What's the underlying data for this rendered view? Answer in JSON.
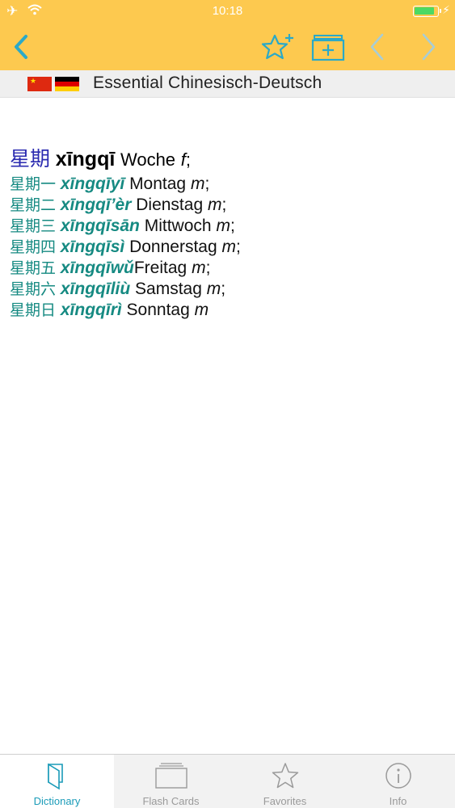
{
  "status": {
    "time": "10:18",
    "battery_level": 0.9
  },
  "colors": {
    "accent": "#2aa9c8",
    "header": "#fdc94f",
    "entry": "#168a82",
    "headword_hanzi": "#2b2bb0"
  },
  "nav": {
    "back_icon": "chevron-left-icon",
    "favorite_icon": "star-plus-icon",
    "flashcard_icon": "folder-plus-icon",
    "prev_icon": "chevron-left-icon",
    "next_icon": "chevron-right-icon"
  },
  "dictionary": {
    "title": "Essential Chinesisch-Deutsch"
  },
  "headword": {
    "hanzi": "星期",
    "pinyin": "xīngqī",
    "translation": "Woche",
    "gender": "f",
    "punct": ";"
  },
  "entries": [
    {
      "hanzi": "星期一",
      "pinyin": "xīngqīyī",
      "translation": "Montag",
      "gender": "m",
      "punct": ";"
    },
    {
      "hanzi": "星期二",
      "pinyin": "xīngqī’èr",
      "translation": "Dienstag",
      "gender": "m",
      "punct": ";"
    },
    {
      "hanzi": "星期三",
      "pinyin": "xīngqīsān",
      "translation": "Mittwoch",
      "gender": "m",
      "punct": ";"
    },
    {
      "hanzi": "星期四",
      "pinyin": "xīngqīsì",
      "translation": "Donnerstag",
      "gender": "m",
      "punct": ";"
    },
    {
      "hanzi": "星期五",
      "pinyin": "xīngqīwǔ",
      "translation": "Freitag",
      "gender": "m",
      "punct": ";"
    },
    {
      "hanzi": "星期六",
      "pinyin": "xīngqīliù",
      "translation": "Samstag",
      "gender": "m",
      "punct": ";"
    },
    {
      "hanzi": "星期日",
      "pinyin": "xīngqīrì",
      "translation": "Sonntag",
      "gender": "m",
      "punct": ""
    }
  ],
  "tabs": [
    {
      "label": "Dictionary",
      "icon": "book-icon",
      "active": true
    },
    {
      "label": "Flash Cards",
      "icon": "cards-icon",
      "active": false
    },
    {
      "label": "Favorites",
      "icon": "star-icon",
      "active": false
    },
    {
      "label": "Info",
      "icon": "info-icon",
      "active": false
    }
  ]
}
